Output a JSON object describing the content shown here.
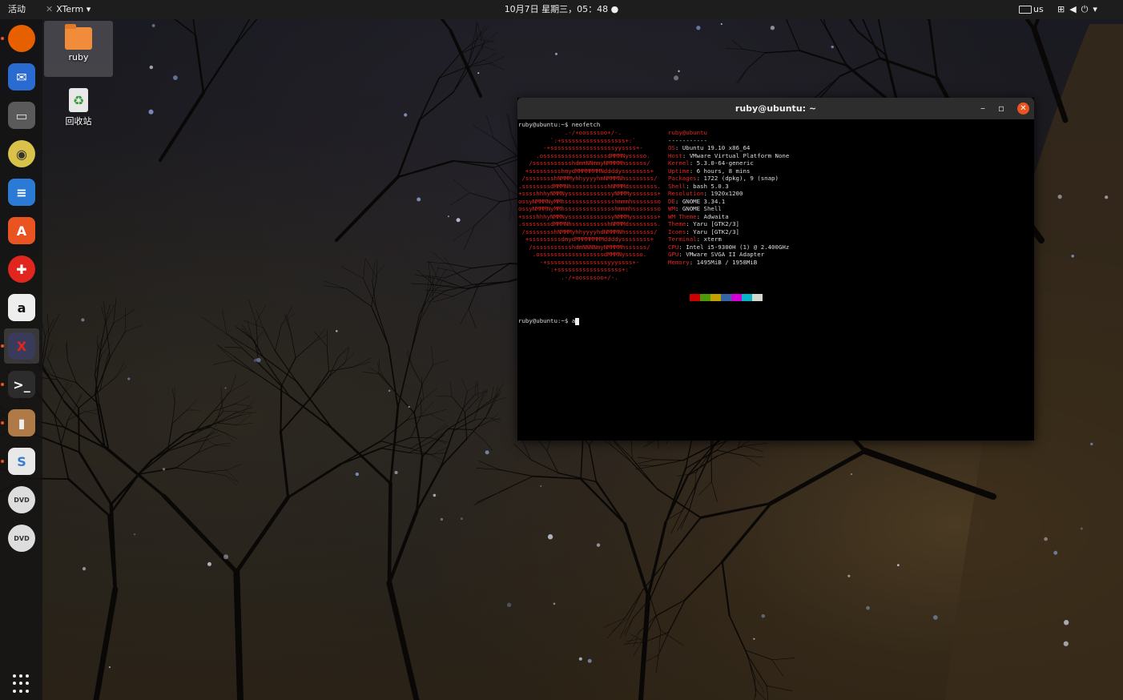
{
  "top_bar": {
    "activities": "活动",
    "app_name": "XTerm",
    "clock": "10月7日 星期三，05：48",
    "keyboard_layout": "us"
  },
  "dock": {
    "items": [
      {
        "name": "firefox",
        "glyph": "",
        "bg": "#e66000",
        "fg": "#ffcb00",
        "running": true
      },
      {
        "name": "thunderbird",
        "glyph": "✉",
        "bg": "#2a6bd1",
        "fg": "#ffffff",
        "running": false
      },
      {
        "name": "files",
        "glyph": "▭",
        "bg": "#5a5a5a",
        "fg": "#dddddd",
        "running": false
      },
      {
        "name": "rhythmbox",
        "glyph": "◉",
        "bg": "#d8c24a",
        "fg": "#333333",
        "running": false
      },
      {
        "name": "libreoffice-writer",
        "glyph": "≡",
        "bg": "#2b7bd6",
        "fg": "#ffffff",
        "running": false
      },
      {
        "name": "software",
        "glyph": "A",
        "bg": "#e95420",
        "fg": "#ffffff",
        "running": false
      },
      {
        "name": "help",
        "glyph": "✚",
        "bg": "#e0261f",
        "fg": "#ffffff",
        "running": false
      },
      {
        "name": "amazon",
        "glyph": "a",
        "bg": "#eeeeee",
        "fg": "#111111",
        "running": false
      },
      {
        "name": "xterm",
        "glyph": "X",
        "bg": "#3a3a5a",
        "fg": "#e0261f",
        "running": true
      },
      {
        "name": "terminal",
        "glyph": ">_",
        "bg": "#2c2c2c",
        "fg": "#ffffff",
        "running": true
      },
      {
        "name": "archive",
        "glyph": "▮",
        "bg": "#b07a48",
        "fg": "#eeeeee",
        "running": true
      },
      {
        "name": "remote",
        "glyph": "S",
        "bg": "#e8e8e8",
        "fg": "#3a7bd5",
        "running": true
      },
      {
        "name": "dvd-1",
        "glyph": "DVD",
        "bg": "#dddddd",
        "fg": "#333333",
        "running": false
      },
      {
        "name": "dvd-2",
        "glyph": "DVD",
        "bg": "#dddddd",
        "fg": "#333333",
        "running": false
      }
    ]
  },
  "desktop": {
    "home_folder": "ruby",
    "trash": "回收站"
  },
  "terminal": {
    "title": "ruby@ubuntu: ~",
    "command_line": "ruby@ubuntu:~$ neofetch",
    "ascii_art": "             .-/+oossssoo+/-.\n         `:+ssssssssssssssssss+:`\n       -+ssssssssssssssssssyyssss+-\n     .ossssssssssssssssssdMMMNysssso.\n   /ssssssssssshdmmNNmmyNMMMMhssssss/\n  +ssssssssshmydMMMMMMMNddddyssssssss+\n /sssssssshNMMMyhhyyyyhmNMMMNhssssssss/\n.ssssssssdMMMNhsssssssssshNMMMdssssssss.\n+sssshhhyNMMNyssssssssssssyNMMMysssssss+\nossyNMMMNyMMhsssssssssssssshmmmhssssssso\nossyNMMMNyMMhsssssssssssssshmmmhssssssso\n+sssshhhyNMMNyssssssssssssyNMMMysssssss+\n.ssssssssdMMMNhsssssssssshNMMMdssssssss.\n /sssssssshNMMMyhhyyyyhdNMMMNhssssssss/\n  +sssssssssdmydMMMMMMMMddddyssssssss+\n   /ssssssssssshdmNNNNmyNMMMMhssssss/\n    .ossssssssssssssssssdMMMNysssso.\n      -+sssssssssssssssssyyyssss+-\n        `:+ssssssssssssssssss+:`\n            .-/+oossssoo+/-.",
    "user_host": "ruby@ubuntu",
    "separator": "-----------",
    "info": [
      {
        "key": "OS",
        "value": "Ubuntu 19.10 x86_64"
      },
      {
        "key": "Host",
        "value": "VMware Virtual Platform None"
      },
      {
        "key": "Kernel",
        "value": "5.3.0-64-generic"
      },
      {
        "key": "Uptime",
        "value": "6 hours, 8 mins"
      },
      {
        "key": "Packages",
        "value": "1722 (dpkg), 9 (snap)"
      },
      {
        "key": "Shell",
        "value": "bash 5.0.3"
      },
      {
        "key": "Resolution",
        "value": "1920x1200"
      },
      {
        "key": "DE",
        "value": "GNOME 3.34.1"
      },
      {
        "key": "WM",
        "value": "GNOME Shell"
      },
      {
        "key": "WM Theme",
        "value": "Adwaita"
      },
      {
        "key": "Theme",
        "value": "Yaru [GTK2/3]"
      },
      {
        "key": "Icons",
        "value": "Yaru [GTK2/3]"
      },
      {
        "key": "Terminal",
        "value": "xterm"
      },
      {
        "key": "CPU",
        "value": "Intel i5-9300H (1) @ 2.400GHz"
      },
      {
        "key": "GPU",
        "value": "VMware SVGA II Adapter"
      },
      {
        "key": "Memory",
        "value": "1495MiB / 1958MiB"
      }
    ],
    "color_swatches": [
      "#000000",
      "#cc0000",
      "#4e9a06",
      "#c4a000",
      "#3465a4",
      "#d600d6",
      "#06b6c8",
      "#d3d7cf"
    ],
    "prompt": "ruby@ubuntu:~$ a"
  }
}
